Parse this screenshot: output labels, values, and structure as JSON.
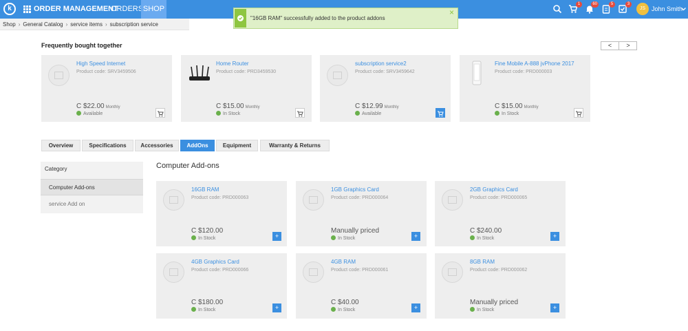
{
  "header": {
    "logo_letter": "k",
    "app_title": "ORDER MANAGEMENT",
    "nav": [
      {
        "label": "ORDERS"
      },
      {
        "label": "SHOP"
      }
    ],
    "cart_badge": "1",
    "notifications_badge": "60",
    "tasks_badge": "5",
    "approvals_badge": "3",
    "user_initials": "JS",
    "user_name": "John Smith"
  },
  "breadcrumb": [
    "Shop",
    "General Catalog",
    "service items",
    "subscription service"
  ],
  "toast": {
    "message": "\"16GB RAM\" successfully added to the product addons"
  },
  "frequently_bought": {
    "title": "Frequently bought together",
    "items": [
      {
        "name": "High Speed Internet",
        "code": "Product code: SRV3459506",
        "price": "C $22.00",
        "period": "Monthly",
        "status": "Available"
      },
      {
        "name": "Home Router",
        "code": "Product code: PRD3459530",
        "price": "C $15.00",
        "period": "Monthly",
        "status": "In Stock"
      },
      {
        "name": "subscription service2",
        "code": "Product code: SRV3459642",
        "price": "C $12.99",
        "period": "Monthly",
        "status": "Available"
      },
      {
        "name": "Fine Mobile A-888 jvPhone 2017",
        "code": "Product code: PRD000003",
        "price": "C $15.00",
        "period": "Monthly",
        "status": "In Stock"
      }
    ]
  },
  "tabs": [
    {
      "label": "Overview"
    },
    {
      "label": "Specifications"
    },
    {
      "label": "Accessories"
    },
    {
      "label": "AddOns"
    },
    {
      "label": "Equipment"
    },
    {
      "label": "Warranty & Returns"
    }
  ],
  "category": {
    "title": "Category",
    "items": [
      {
        "label": "Computer Add-ons"
      },
      {
        "label": "service Add on"
      }
    ]
  },
  "addons": {
    "title": "Computer Add-ons",
    "add_label": "+",
    "items": [
      {
        "name": "16GB RAM",
        "code": "Product code: PRD000063",
        "price": "C $120.00",
        "status": "In Stock"
      },
      {
        "name": "1GB Graphics Card",
        "code": "Product code: PRD000064",
        "price": "Manually priced",
        "status": "In Stock"
      },
      {
        "name": "2GB Graphics Card",
        "code": "Product code: PRD000065",
        "price": "C $240.00",
        "status": "In Stock"
      },
      {
        "name": "4GB Graphics Card",
        "code": "Product code: PRD000066",
        "price": "C $180.00",
        "status": "In Stock"
      },
      {
        "name": "4GB RAM",
        "code": "Product code: PRD000061",
        "price": "C $40.00",
        "status": "In Stock"
      },
      {
        "name": "8GB RAM",
        "code": "Product code: PRD000062",
        "price": "Manually priced",
        "status": "In Stock"
      }
    ]
  },
  "pager": {
    "prev": "<",
    "next": ">"
  },
  "colors": {
    "accent": "#3b8fe0",
    "success": "#8ec641",
    "badge": "#e74c3c"
  }
}
